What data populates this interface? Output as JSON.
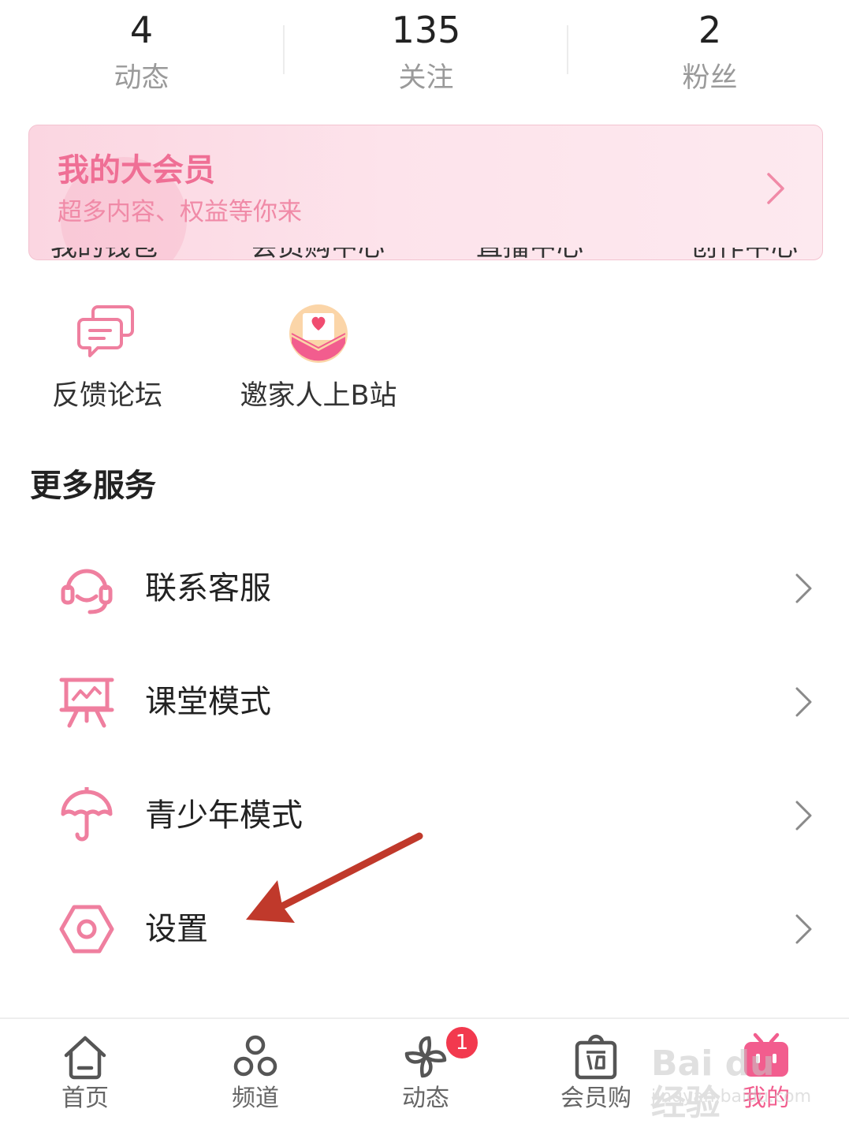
{
  "stats": [
    {
      "value": "4",
      "label": "动态"
    },
    {
      "value": "135",
      "label": "关注"
    },
    {
      "value": "2",
      "label": "粉丝"
    }
  ],
  "vip": {
    "title": "我的大会员",
    "subtitle": "超多内容、权益等你来"
  },
  "partial_row": [
    "我的钱包",
    "会员购中心",
    "直播中心",
    "创作中心"
  ],
  "tools": [
    {
      "label": "反馈论坛",
      "icon": "feedback-forum-icon"
    },
    {
      "label": "邀家人上B站",
      "icon": "invite-family-icon"
    }
  ],
  "more_services": {
    "title": "更多服务",
    "items": [
      {
        "label": "联系客服",
        "icon": "headset-icon"
      },
      {
        "label": "课堂模式",
        "icon": "classroom-board-icon"
      },
      {
        "label": "青少年模式",
        "icon": "umbrella-icon"
      },
      {
        "label": "设置",
        "icon": "settings-hexagon-icon"
      }
    ]
  },
  "tabbar": {
    "items": [
      {
        "label": "首页",
        "icon": "home-icon",
        "active": false
      },
      {
        "label": "频道",
        "icon": "channel-icon",
        "active": false
      },
      {
        "label": "动态",
        "icon": "pinwheel-icon",
        "active": false,
        "badge": "1"
      },
      {
        "label": "会员购",
        "icon": "shopping-bag-icon",
        "active": false
      },
      {
        "label": "我的",
        "icon": "tv-mine-icon",
        "active": true
      }
    ]
  },
  "watermark": {
    "line1": "Bai du 经验",
    "line2": "jingyan.baidu.com"
  },
  "colors": {
    "accent": "#f25d8e",
    "vip_title": "#ef6f95",
    "badge": "#f2394e",
    "annotation": "#c0392b"
  }
}
